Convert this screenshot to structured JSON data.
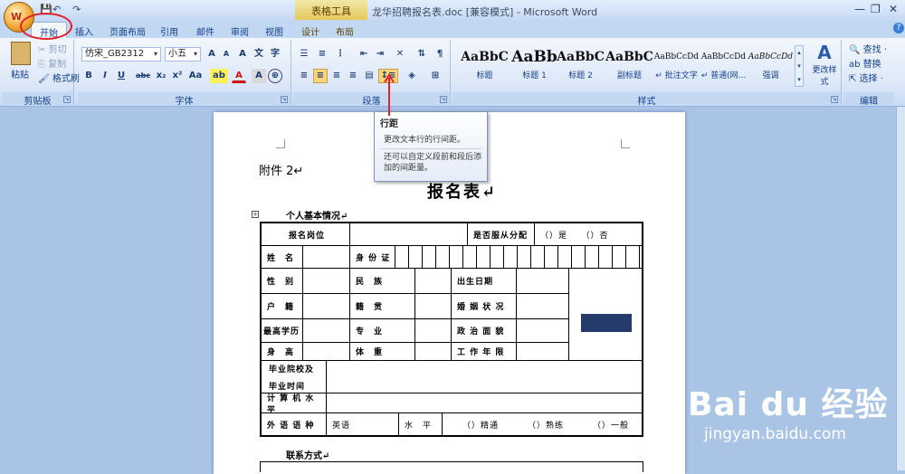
{
  "title_bar": {
    "document_title": "龙华招聘报名表.doc [兼容模式] - Microsoft Word",
    "contextual_tab_group": "表格工具",
    "qat_save": "💾",
    "qat_undo": "↶",
    "qat_redo": "↷",
    "office_button_label": "W"
  },
  "tabs": [
    "开始",
    "插入",
    "页面布局",
    "引用",
    "邮件",
    "审阅",
    "视图",
    "设计",
    "布局"
  ],
  "ribbon": {
    "clipboard": {
      "label": "剪贴板",
      "paste": "粘贴",
      "cut": "剪切",
      "copy": "复制",
      "format_painter": "格式刷"
    },
    "font": {
      "label": "字体",
      "font_name": "仿宋_GB2312",
      "font_size": "小五",
      "bold": "B",
      "italic": "I",
      "underline": "U",
      "strike": "abc",
      "subscript": "x₂",
      "superscript": "x²",
      "change_case": "Aa",
      "grow": "A",
      "shrink": "A",
      "clear": "A",
      "highlight": "ab",
      "font_color": "A",
      "char_border": "A",
      "phonetic": "文",
      "enclose": "字"
    },
    "paragraph": {
      "label": "段落"
    },
    "styles": {
      "label": "样式",
      "items": [
        {
          "sample": "AaBbC",
          "name": "标题"
        },
        {
          "sample": "AaBb",
          "name": "标题 1"
        },
        {
          "sample": "AaBbC",
          "name": "标题 2"
        },
        {
          "sample": "AaBbC",
          "name": "副标题"
        },
        {
          "sample": "AaBbCcDd",
          "name": "↵ 批注文字"
        },
        {
          "sample": "AaBbCcDd",
          "name": "↵ 普通(网..."
        },
        {
          "sample": "AaBbCcDd",
          "name": "强调"
        }
      ],
      "change_styles": "更改样式"
    },
    "editing": {
      "label": "编辑",
      "find": "查找 ·",
      "replace": "替换",
      "select": "选择 ·"
    }
  },
  "tooltip": {
    "title": "行距",
    "line1": "更改文本行的行间距。",
    "line2": "还可以自定义段前和段后添加的间距量。"
  },
  "document": {
    "attachment": "附件 2↵",
    "form_title": "报名表↵",
    "section_personal": "个人基本情况↵",
    "section_contact": "联系方式↵",
    "cells": {
      "position": "报名岗位",
      "obey_assignment": "是否服从分配",
      "yes": "（）是",
      "no": "（）否",
      "name": "姓　名",
      "id_card": "身 份 证",
      "gender": "性　别",
      "ethnicity": "民　族",
      "birth_date": "出生日期",
      "hukou": "户　籍",
      "native_place": "籍　贯",
      "marital_status": "婚 姻 状 况",
      "education": "最高学历",
      "major": "专　业",
      "political_status": "政 治 面 貌",
      "height": "身　高",
      "weight": "体　重",
      "work_years": "工 作 年 限",
      "school_graduation": "毕业院校及",
      "graduation_time": "毕业时间",
      "computer_level": "计 算 机 水 平",
      "foreign_language": "外 语 语 种",
      "english": "英语",
      "level": "水　平",
      "fluent": "（）精通",
      "proficient": "（）熟练",
      "general": "（）一般"
    }
  },
  "watermark": {
    "brand": "Bai du 经验",
    "url": "jingyan.baidu.com"
  },
  "colors": {
    "ribbon_text": "#15428b",
    "annotation_red": "#e0202a",
    "page_bg": "#aac4e6"
  }
}
